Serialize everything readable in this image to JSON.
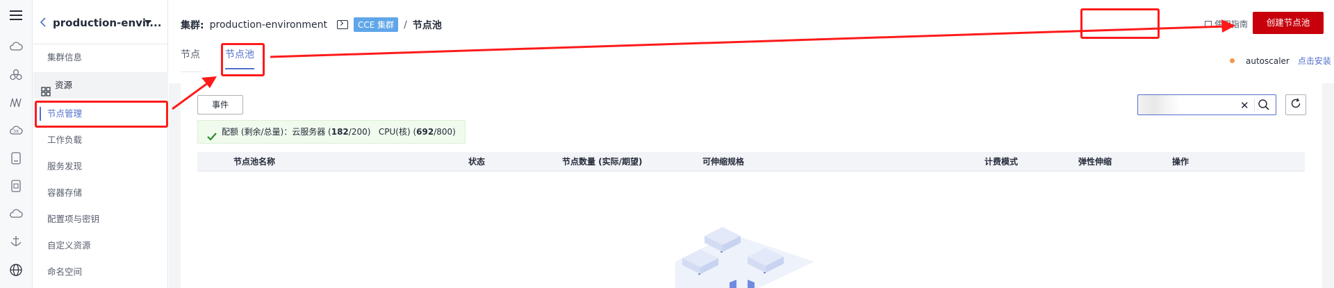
{
  "rail": {
    "icons": [
      "menu-icon",
      "cloud-icon",
      "cluster-icon",
      "network-icon",
      "cloud-database-icon",
      "storage-icon",
      "container-icon",
      "cloud-outline-icon",
      "anchor-icon",
      "globe-icon"
    ]
  },
  "sidebar": {
    "cluster_name": "production-envir...",
    "items": [
      {
        "label": "集群信息"
      },
      {
        "label": "资源"
      },
      {
        "label": "节点管理"
      },
      {
        "label": "工作负载"
      },
      {
        "label": "服务发现"
      },
      {
        "label": "容器存储"
      },
      {
        "label": "配置项与密钥"
      },
      {
        "label": "自定义资源"
      },
      {
        "label": "命名空间"
      }
    ]
  },
  "breadcrumb": {
    "label": "集群:",
    "cluster": "production-environment",
    "tag": "CCE 集群",
    "sep": "/",
    "current": "节点池"
  },
  "header": {
    "guide_label": "使用指南",
    "create_label": "创建节点池"
  },
  "tabs": [
    {
      "label": "节点"
    },
    {
      "label": "节点池"
    }
  ],
  "autoscaler": {
    "name": "autoscaler",
    "action": "点击安装",
    "status_color": "#f79646"
  },
  "toolbar": {
    "events_label": "事件"
  },
  "quota": {
    "prefix": "配额 (剩余/总量)：云服务器 (",
    "ecs_remaining": "182",
    "ecs_total": "/200)",
    "cpu_prefix": "CPU(核) (",
    "cpu_remaining": "692",
    "cpu_total": "/800)"
  },
  "table": {
    "columns": [
      "节点池名称",
      "状态",
      "节点数量 (实际/期望)",
      "可伸缩规格",
      "计费模式",
      "弹性伸缩",
      "操作"
    ]
  },
  "colors": {
    "accent": "#526ecc",
    "primary_button": "#c7000b",
    "annotation": "#ff1a1a"
  }
}
